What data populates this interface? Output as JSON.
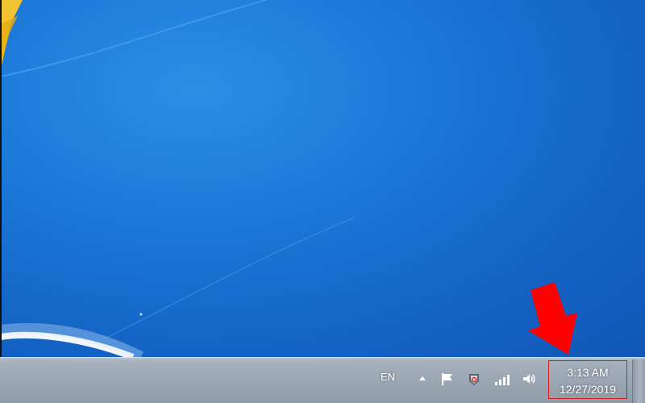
{
  "taskbar": {
    "language": "EN",
    "tray_icons": [
      "show-hidden-icons-arrow-icon",
      "action-center-flag-icon",
      "security-shield-icon",
      "network-signal-icon",
      "volume-icon"
    ]
  },
  "clock": {
    "time": "3:13 AM",
    "date": "12/27/2019"
  },
  "colors": {
    "desktop_blue": "#1b79d8",
    "highlight_box": "#d81c1c",
    "arrow": "#ff0000"
  }
}
